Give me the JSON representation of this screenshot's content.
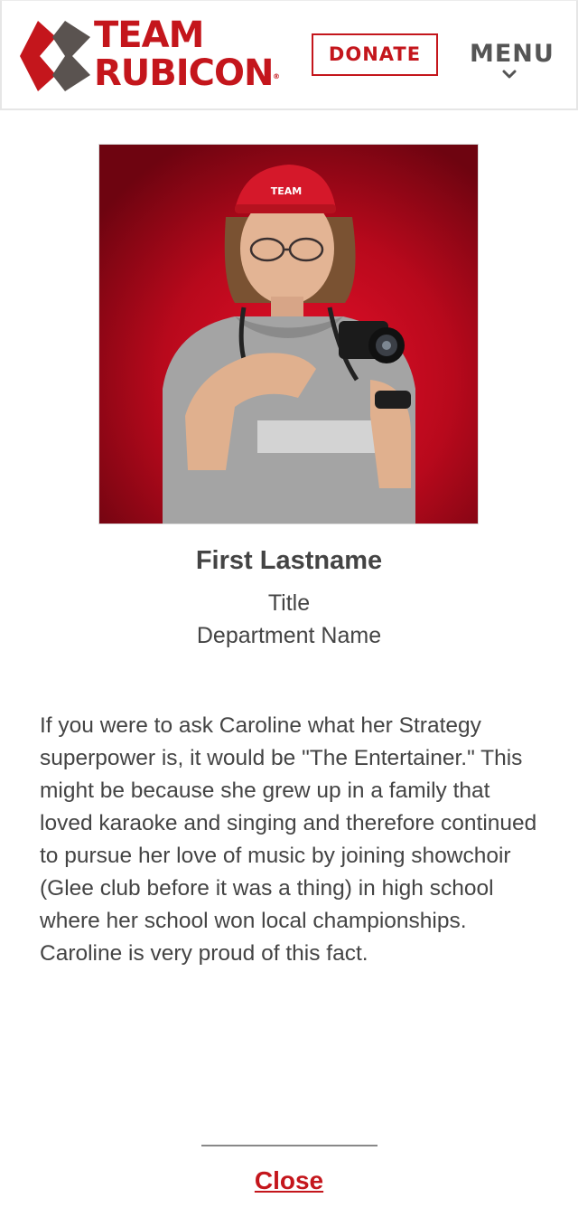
{
  "header": {
    "logo": {
      "line1": "TEAM",
      "line2": "RUBICON",
      "registered": "®"
    },
    "donate_label": "DONATE",
    "menu_label": "MENU"
  },
  "profile": {
    "photo_icon": "portrait-photo",
    "name": "First Lastname",
    "title": "Title",
    "department": "Department Name",
    "bio": "If you were to ask Caroline what her Strategy superpower is, it would be \"The Entertainer.\" This might be because she grew up in a family that loved karaoke and singing and therefore continued to pursue her love of music by joining showchoir (Glee club before it was a thing) in high school where her school won local championships. Caroline is very proud of this fact."
  },
  "footer": {
    "close_label": "Close"
  },
  "colors": {
    "brand_red": "#c4161c",
    "text_gray": "#444444",
    "logo_gray": "#5a5350"
  }
}
